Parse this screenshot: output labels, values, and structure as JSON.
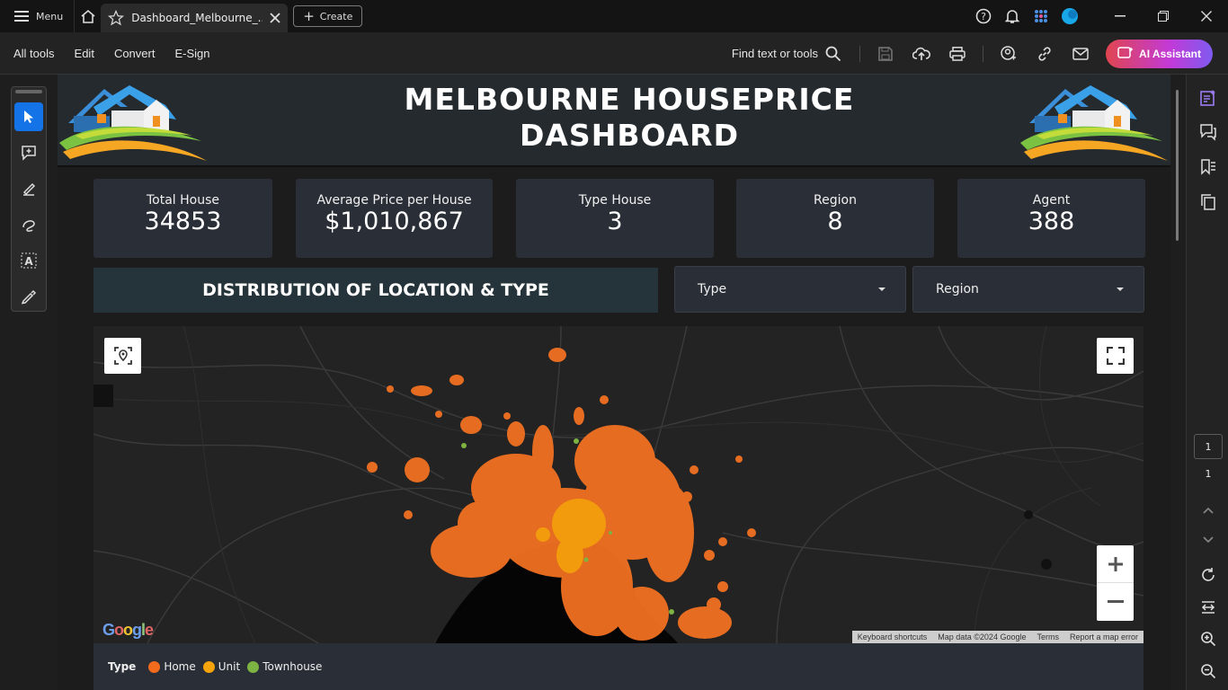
{
  "titlebar": {
    "menu_label": "Menu",
    "tab_title": "Dashboard_Melbourne_...",
    "create_label": "Create"
  },
  "toolbar": {
    "menus": [
      "All tools",
      "Edit",
      "Convert",
      "E-Sign"
    ],
    "find_label": "Find text or tools",
    "ai_label": "AI Assistant"
  },
  "dashboard": {
    "title_line1": "MELBOURNE HOUSEPRICE",
    "title_line2": "DASHBOARD",
    "kpis": [
      {
        "label": "Total House",
        "value": "34853"
      },
      {
        "label": "Average Price per House",
        "value": "$1,010,867"
      },
      {
        "label": "Type House",
        "value": "3"
      },
      {
        "label": "Region",
        "value": "8"
      },
      {
        "label": "Agent",
        "value": "388"
      }
    ],
    "section_title": "DISTRIBUTION OF LOCATION & TYPE",
    "filters": {
      "type_label": "Type",
      "region_label": "Region"
    },
    "map": {
      "logo": "Google",
      "attribution": [
        "Keyboard shortcuts",
        "Map data ©2024 Google",
        "Terms",
        "Report a map error"
      ]
    },
    "legend": {
      "title": "Type",
      "items": [
        {
          "label": "Home",
          "color": "#f26b1d"
        },
        {
          "label": "Unit",
          "color": "#f5a40a"
        },
        {
          "label": "Townhouse",
          "color": "#7cb342"
        }
      ]
    }
  },
  "pagination": {
    "current": "1",
    "total": "1"
  },
  "colors": {
    "accent": "#1473e6",
    "orange": "#f26b1d",
    "panel": "#2a2e37"
  }
}
